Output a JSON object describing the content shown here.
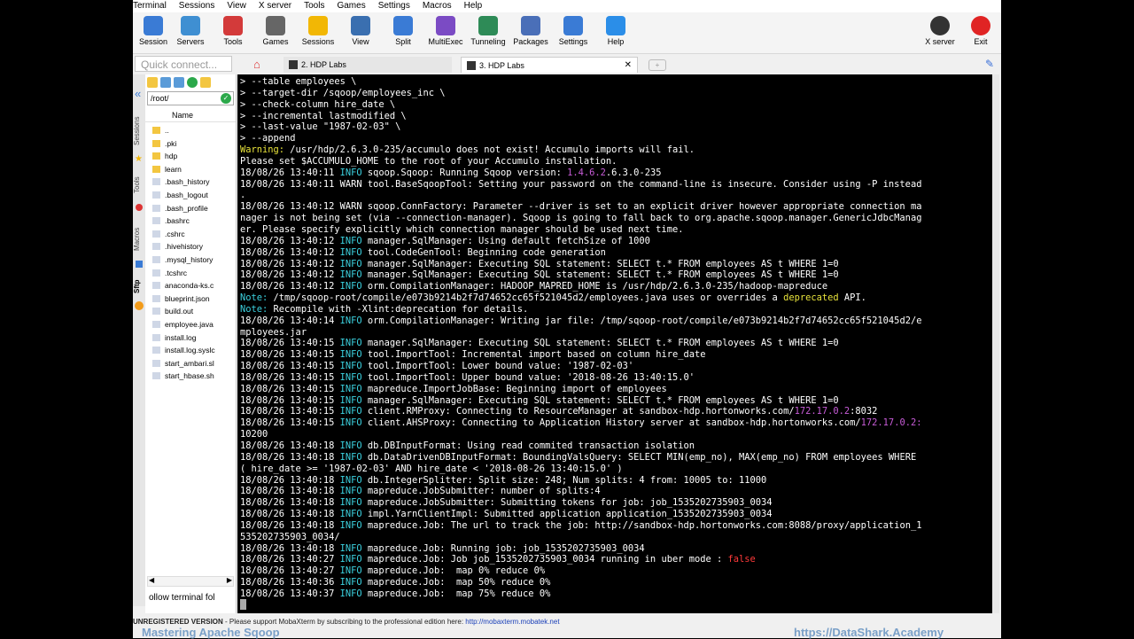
{
  "menubar": [
    "Terminal",
    "Sessions",
    "View",
    "X server",
    "Tools",
    "Games",
    "Settings",
    "Macros",
    "Help"
  ],
  "toolbar": {
    "left": [
      {
        "label": "Session",
        "icon": "session-icon",
        "color": "#3a7bd5"
      },
      {
        "label": "Servers",
        "icon": "servers-icon",
        "color": "#3f8fd2"
      },
      {
        "label": "Tools",
        "icon": "tools-icon",
        "color": "#d33a3a"
      },
      {
        "label": "Games",
        "icon": "games-icon",
        "color": "#666666"
      },
      {
        "label": "Sessions",
        "icon": "star-icon",
        "color": "#f2b705"
      },
      {
        "label": "View",
        "icon": "view-icon",
        "color": "#3a6fb0"
      },
      {
        "label": "Split",
        "icon": "split-icon",
        "color": "#3a7bd5"
      },
      {
        "label": "MultiExec",
        "icon": "multiexec-icon",
        "color": "#7b4bc4"
      },
      {
        "label": "Tunneling",
        "icon": "tunneling-icon",
        "color": "#2e8b57"
      },
      {
        "label": "Packages",
        "icon": "packages-icon",
        "color": "#4a6fb8"
      },
      {
        "label": "Settings",
        "icon": "settings-icon",
        "color": "#3a7bd5"
      },
      {
        "label": "Help",
        "icon": "help-icon",
        "color": "#2b8ee8"
      }
    ],
    "right": [
      {
        "label": "X server",
        "icon": "x-server-icon",
        "color": "#333333"
      },
      {
        "label": "Exit",
        "icon": "exit-icon",
        "color": "#e02424"
      }
    ]
  },
  "quick_connect_placeholder": "Quick connect...",
  "tabs": [
    {
      "label": "2. HDP Labs"
    },
    {
      "label": "3. HDP Labs",
      "active": true
    }
  ],
  "left_strip": [
    "Sessions",
    "Tools",
    "Macros",
    "Sftp"
  ],
  "file_panel": {
    "path": "/root/",
    "column_name": "Name",
    "files": [
      {
        "name": "..",
        "type": "folder"
      },
      {
        "name": ".pki",
        "type": "folder"
      },
      {
        "name": "hdp",
        "type": "folder"
      },
      {
        "name": "learn",
        "type": "folder"
      },
      {
        "name": ".bash_history",
        "type": "file"
      },
      {
        "name": ".bash_logout",
        "type": "file"
      },
      {
        "name": ".bash_profile",
        "type": "file"
      },
      {
        "name": ".bashrc",
        "type": "file"
      },
      {
        "name": ".cshrc",
        "type": "file"
      },
      {
        "name": ".hivehistory",
        "type": "file"
      },
      {
        "name": ".mysql_history",
        "type": "file"
      },
      {
        "name": ".tcshrc",
        "type": "file"
      },
      {
        "name": "anaconda-ks.c",
        "type": "file"
      },
      {
        "name": "blueprint.json",
        "type": "file"
      },
      {
        "name": "build.out",
        "type": "file"
      },
      {
        "name": "employee.java",
        "type": "file"
      },
      {
        "name": "install.log",
        "type": "file"
      },
      {
        "name": "install.log.syslc",
        "type": "file"
      },
      {
        "name": "start_ambari.sl",
        "type": "file"
      },
      {
        "name": "start_hbase.sh",
        "type": "file"
      }
    ],
    "follow_label": "ollow terminal fol"
  },
  "terminal": {
    "lines": [
      [
        {
          "t": "> --table employees \\"
        }
      ],
      [
        {
          "t": "> --target-dir /sqoop/employees_inc \\"
        }
      ],
      [
        {
          "t": "> --check-column hire_date \\"
        }
      ],
      [
        {
          "t": "> --incremental lastmodified \\"
        }
      ],
      [
        {
          "t": "> --last-value \"1987-02-03\" \\"
        }
      ],
      [
        {
          "t": "> --append"
        }
      ],
      [
        {
          "t": "Warning:",
          "c": "yellow"
        },
        {
          "t": " /usr/hdp/2.6.3.0-235/accumulo does not exist! Accumulo imports will fail."
        }
      ],
      [
        {
          "t": "Please set $ACCUMULO_HOME to the root of your Accumulo installation."
        }
      ],
      [
        {
          "t": "18/08/26 13:40:11 "
        },
        {
          "t": "INFO",
          "c": "cyan"
        },
        {
          "t": " sqoop.Sqoop: Running Sqoop version: "
        },
        {
          "t": "1.4.6.2",
          "c": "mag"
        },
        {
          "t": ".6.3.0-235"
        }
      ],
      [
        {
          "t": "18/08/26 13:40:11 WARN tool.BaseSqoopTool: Setting your password on the command-line is insecure. Consider using -P instead"
        }
      ],
      [
        {
          "t": "."
        }
      ],
      [
        {
          "t": "18/08/26 13:40:12 WARN sqoop.ConnFactory: Parameter --driver is set to an explicit driver however appropriate connection ma"
        }
      ],
      [
        {
          "t": "nager is not being set (via --connection-manager). Sqoop is going to fall back to org.apache.sqoop.manager.GenericJdbcManag"
        }
      ],
      [
        {
          "t": "er. Please specify explicitly which connection manager should be used next time."
        }
      ],
      [
        {
          "t": "18/08/26 13:40:12 "
        },
        {
          "t": "INFO",
          "c": "cyan"
        },
        {
          "t": " manager.SqlManager: Using default fetchSize of 1000"
        }
      ],
      [
        {
          "t": "18/08/26 13:40:12 "
        },
        {
          "t": "INFO",
          "c": "cyan"
        },
        {
          "t": " tool.CodeGenTool: Beginning code generation"
        }
      ],
      [
        {
          "t": "18/08/26 13:40:12 "
        },
        {
          "t": "INFO",
          "c": "cyan"
        },
        {
          "t": " manager.SqlManager: Executing SQL statement: SELECT t.* FROM employees AS t WHERE 1=0"
        }
      ],
      [
        {
          "t": "18/08/26 13:40:12 "
        },
        {
          "t": "INFO",
          "c": "cyan"
        },
        {
          "t": " manager.SqlManager: Executing SQL statement: SELECT t.* FROM employees AS t WHERE 1=0"
        }
      ],
      [
        {
          "t": "18/08/26 13:40:12 "
        },
        {
          "t": "INFO",
          "c": "cyan"
        },
        {
          "t": " orm.CompilationManager: HADOOP_MAPRED_HOME is /usr/hdp/2.6.3.0-235/hadoop-mapreduce"
        }
      ],
      [
        {
          "t": "Note:",
          "c": "cyan"
        },
        {
          "t": " /tmp/sqoop-root/compile/e073b9214b2f7d74652cc65f521045d2/employees.java uses or overrides a "
        },
        {
          "t": "deprecated",
          "c": "yellow"
        },
        {
          "t": " API."
        }
      ],
      [
        {
          "t": "Note:",
          "c": "cyan"
        },
        {
          "t": " Recompile with -Xlint:deprecation for details."
        }
      ],
      [
        {
          "t": "18/08/26 13:40:14 "
        },
        {
          "t": "INFO",
          "c": "cyan"
        },
        {
          "t": " orm.CompilationManager: Writing jar file: /tmp/sqoop-root/compile/e073b9214b2f7d74652cc65f521045d2/e"
        }
      ],
      [
        {
          "t": "mployees.jar"
        }
      ],
      [
        {
          "t": "18/08/26 13:40:15 "
        },
        {
          "t": "INFO",
          "c": "cyan"
        },
        {
          "t": " manager.SqlManager: Executing SQL statement: SELECT t.* FROM employees AS t WHERE 1=0"
        }
      ],
      [
        {
          "t": "18/08/26 13:40:15 "
        },
        {
          "t": "INFO",
          "c": "cyan"
        },
        {
          "t": " tool.ImportTool: Incremental import based on column hire_date"
        }
      ],
      [
        {
          "t": "18/08/26 13:40:15 "
        },
        {
          "t": "INFO",
          "c": "cyan"
        },
        {
          "t": " tool.ImportTool: Lower bound value: '1987-02-03'"
        }
      ],
      [
        {
          "t": "18/08/26 13:40:15 "
        },
        {
          "t": "INFO",
          "c": "cyan"
        },
        {
          "t": " tool.ImportTool: Upper bound value: '2018-08-26 13:40:15.0'"
        }
      ],
      [
        {
          "t": "18/08/26 13:40:15 "
        },
        {
          "t": "INFO",
          "c": "cyan"
        },
        {
          "t": " mapreduce.ImportJobBase: Beginning import of employees"
        }
      ],
      [
        {
          "t": "18/08/26 13:40:15 "
        },
        {
          "t": "INFO",
          "c": "cyan"
        },
        {
          "t": " manager.SqlManager: Executing SQL statement: SELECT t.* FROM employees AS t WHERE 1=0"
        }
      ],
      [
        {
          "t": "18/08/26 13:40:15 "
        },
        {
          "t": "INFO",
          "c": "cyan"
        },
        {
          "t": " client.RMProxy: Connecting to ResourceManager at sandbox-hdp.hortonworks.com/"
        },
        {
          "t": "172.17.0.2",
          "c": "mag"
        },
        {
          "t": ":8032"
        }
      ],
      [
        {
          "t": "18/08/26 13:40:15 "
        },
        {
          "t": "INFO",
          "c": "cyan"
        },
        {
          "t": " client.AHSProxy: Connecting to Application History server at sandbox-hdp.hortonworks.com/"
        },
        {
          "t": "172.17.0.2:",
          "c": "mag"
        }
      ],
      [
        {
          "t": "10200"
        }
      ],
      [
        {
          "t": "18/08/26 13:40:18 "
        },
        {
          "t": "INFO",
          "c": "cyan"
        },
        {
          "t": " db.DBInputFormat: Using read commited transaction isolation"
        }
      ],
      [
        {
          "t": "18/08/26 13:40:18 "
        },
        {
          "t": "INFO",
          "c": "cyan"
        },
        {
          "t": " db.DataDrivenDBInputFormat: BoundingValsQuery: SELECT MIN(emp_no), MAX(emp_no) FROM employees WHERE"
        }
      ],
      [
        {
          "t": "( hire_date >= '1987-02-03' AND hire_date < '2018-08-26 13:40:15.0' )"
        }
      ],
      [
        {
          "t": "18/08/26 13:40:18 "
        },
        {
          "t": "INFO",
          "c": "cyan"
        },
        {
          "t": " db.IntegerSplitter: Split size: 248; Num splits: 4 from: 10005 to: 11000"
        }
      ],
      [
        {
          "t": "18/08/26 13:40:18 "
        },
        {
          "t": "INFO",
          "c": "cyan"
        },
        {
          "t": " mapreduce.JobSubmitter: number of splits:4"
        }
      ],
      [
        {
          "t": "18/08/26 13:40:18 "
        },
        {
          "t": "INFO",
          "c": "cyan"
        },
        {
          "t": " mapreduce.JobSubmitter: Submitting tokens for job: job_1535202735903_0034"
        }
      ],
      [
        {
          "t": "18/08/26 13:40:18 "
        },
        {
          "t": "INFO",
          "c": "cyan"
        },
        {
          "t": " impl.YarnClientImpl: Submitted application application_1535202735903_0034"
        }
      ],
      [
        {
          "t": "18/08/26 13:40:18 "
        },
        {
          "t": "INFO",
          "c": "cyan"
        },
        {
          "t": " mapreduce.Job: The url to track the job: http://sandbox-hdp.hortonworks.com:8088/proxy/application_1"
        }
      ],
      [
        {
          "t": "535202735903_0034/"
        }
      ],
      [
        {
          "t": "18/08/26 13:40:18 "
        },
        {
          "t": "INFO",
          "c": "cyan"
        },
        {
          "t": " mapreduce.Job: Running job: job_1535202735903_0034"
        }
      ],
      [
        {
          "t": "18/08/26 13:40:27 "
        },
        {
          "t": "INFO",
          "c": "cyan"
        },
        {
          "t": " mapreduce.Job: Job job_1535202735903_0034 running in uber mode : "
        },
        {
          "t": "false",
          "c": "red"
        }
      ],
      [
        {
          "t": "18/08/26 13:40:27 "
        },
        {
          "t": "INFO",
          "c": "cyan"
        },
        {
          "t": " mapreduce.Job:  map 0% reduce 0%"
        }
      ],
      [
        {
          "t": "18/08/26 13:40:36 "
        },
        {
          "t": "INFO",
          "c": "cyan"
        },
        {
          "t": " mapreduce.Job:  map 50% reduce 0%"
        }
      ],
      [
        {
          "t": "18/08/26 13:40:37 "
        },
        {
          "t": "INFO",
          "c": "cyan"
        },
        {
          "t": " mapreduce.Job:  map 75% reduce 0%"
        }
      ]
    ]
  },
  "status": {
    "unregistered": "UNREGISTERED VERSION",
    "message": "  -  Please support MobaXterm by subscribing to the professional edition here:  ",
    "link": "http://mobaxterm.mobatek.net"
  },
  "banner": {
    "left": "Mastering Apache Sqoop",
    "right": "https://DataShark.Academy"
  }
}
